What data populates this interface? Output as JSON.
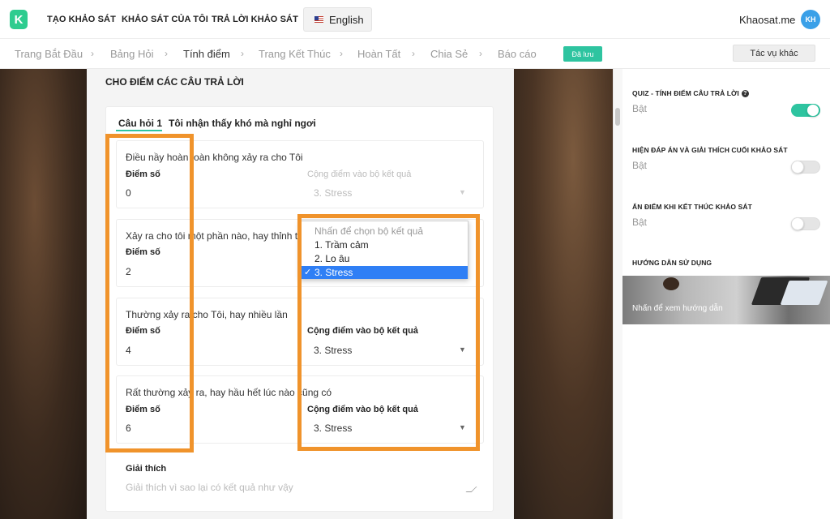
{
  "nav": {
    "logo_letter": "K",
    "create": "TẠO KHẢO SÁT",
    "mine": "KHẢO SÁT CỦA TÔI",
    "answer": "TRẢ LỜI KHẢO SÁT",
    "language": "English",
    "brand": "Khaosat.me",
    "avatar_initials": "KH"
  },
  "steps": {
    "start": "Trang Bắt Đầu",
    "questions": "Bảng Hỏi",
    "scoring": "Tính điểm",
    "end_page": "Trang Kết Thúc",
    "done": "Hoàn Tất",
    "share": "Chia Sẻ",
    "report": "Báo cáo",
    "separator": "›",
    "saved_badge": "Đã lưu",
    "more_actions": "Tác vụ khác"
  },
  "main": {
    "section_title": "CHO ĐIỂM CÁC CÂU TRẢ LỜI",
    "question_tab": "Câu hỏi 1",
    "question_text": "Tôi nhận thấy khó mà nghỉ ngơi",
    "score_label": "Điểm số",
    "result_label": "Cộng điểm vào bộ kết quả",
    "answers": [
      {
        "text": "Điều nầy hoàn toàn không xảy ra cho Tôi",
        "score": "0",
        "result": "3. Stress"
      },
      {
        "text": "Xảy ra cho tôi một phần nào, hay thỉnh thoảng mới xảy ra",
        "score": "2",
        "result": "3. Stress"
      },
      {
        "text": "Thường xảy ra cho Tôi, hay nhiều lần",
        "score": "4",
        "result": "3. Stress"
      },
      {
        "text": "Rất thường xảy ra, hay hầu hết lúc nào cũng có",
        "score": "6",
        "result": "3. Stress"
      }
    ],
    "explain_label": "Giải thích",
    "explain_placeholder": "Giải thích vì sao lại có kết quả như vậy",
    "caret": "▼"
  },
  "dropdown": {
    "placeholder": "Nhấn để chọn bộ kết quả",
    "options": [
      "1. Trầm cảm",
      "2. Lo âu",
      "3. Stress"
    ],
    "selected_index": 2,
    "check": "✓"
  },
  "sidebar": {
    "quiz_title": "QUIZ - TÍNH ĐIỂM CÂU TRẢ LỜI",
    "quiz_state": "Bật",
    "show_answers_title": "HIỆN ĐÁP ÁN VÀ GIẢI THÍCH CUỐI KHẢO SÁT",
    "show_answers_state": "Bật",
    "hide_score_title": "ẨN ĐIỂM KHI KẾT THÚC KHẢO SÁT",
    "hide_score_state": "Bật",
    "guide_title": "HƯỚNG DẪN SỬ DỤNG",
    "guide_caption": "Nhấn để xem hướng dẫn"
  },
  "colors": {
    "accent": "#2ec4a0",
    "highlight": "#f0932b",
    "selected": "#2f7ff5"
  },
  "toggles": {
    "quiz": true,
    "show_answers": false,
    "hide_score": false
  }
}
